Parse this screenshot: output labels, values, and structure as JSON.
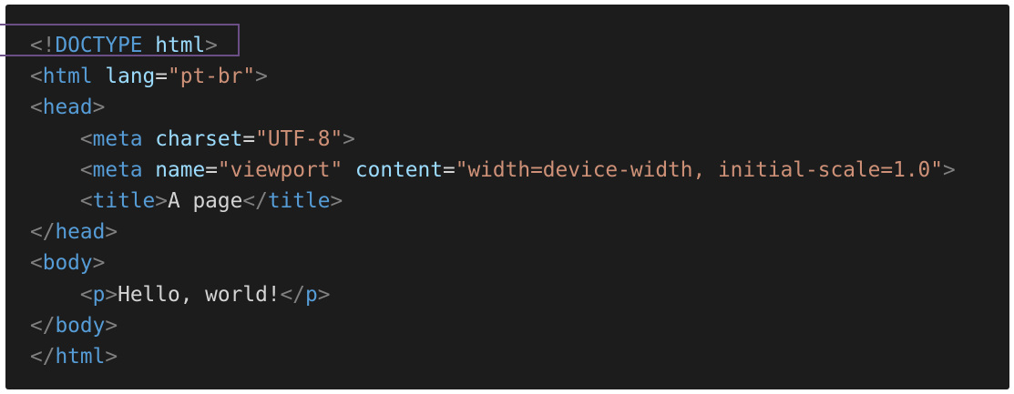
{
  "colors": {
    "background": "#1c1c1c",
    "punct": "#808080",
    "tag": "#569cd6",
    "attr": "#9cdcfe",
    "string": "#ce9178",
    "text": "#d4d4d4",
    "highlight": "#6b4e86"
  },
  "lines": [
    {
      "indent": 0,
      "tokens": [
        [
          "p",
          "<!"
        ],
        [
          "t",
          "DOCTYPE"
        ],
        [
          "x",
          " "
        ],
        [
          "a",
          "html"
        ],
        [
          "p",
          ">"
        ]
      ]
    },
    {
      "indent": 0,
      "tokens": [
        [
          "p",
          "<"
        ],
        [
          "t",
          "html"
        ],
        [
          "x",
          " "
        ],
        [
          "a",
          "lang"
        ],
        [
          "x",
          "="
        ],
        [
          "s",
          "\"pt-br\""
        ],
        [
          "p",
          ">"
        ]
      ]
    },
    {
      "indent": 0,
      "tokens": [
        [
          "p",
          "<"
        ],
        [
          "t",
          "head"
        ],
        [
          "p",
          ">"
        ]
      ]
    },
    {
      "indent": 1,
      "tokens": [
        [
          "p",
          "<"
        ],
        [
          "t",
          "meta"
        ],
        [
          "x",
          " "
        ],
        [
          "a",
          "charset"
        ],
        [
          "x",
          "="
        ],
        [
          "s",
          "\"UTF-8\""
        ],
        [
          "p",
          ">"
        ]
      ]
    },
    {
      "indent": 1,
      "tokens": [
        [
          "p",
          "<"
        ],
        [
          "t",
          "meta"
        ],
        [
          "x",
          " "
        ],
        [
          "a",
          "name"
        ],
        [
          "x",
          "="
        ],
        [
          "s",
          "\"viewport\""
        ],
        [
          "x",
          " "
        ],
        [
          "a",
          "content"
        ],
        [
          "x",
          "="
        ],
        [
          "s",
          "\"width=device-width, initial-scale=1.0\""
        ],
        [
          "p",
          ">"
        ]
      ]
    },
    {
      "indent": 1,
      "tokens": [
        [
          "p",
          "<"
        ],
        [
          "t",
          "title"
        ],
        [
          "p",
          ">"
        ],
        [
          "x",
          "A page"
        ],
        [
          "p",
          "</"
        ],
        [
          "t",
          "title"
        ],
        [
          "p",
          ">"
        ]
      ]
    },
    {
      "indent": 0,
      "tokens": [
        [
          "p",
          "</"
        ],
        [
          "t",
          "head"
        ],
        [
          "p",
          ">"
        ]
      ]
    },
    {
      "indent": 0,
      "tokens": [
        [
          "p",
          "<"
        ],
        [
          "t",
          "body"
        ],
        [
          "p",
          ">"
        ]
      ]
    },
    {
      "indent": 1,
      "tokens": [
        [
          "p",
          "<"
        ],
        [
          "t",
          "p"
        ],
        [
          "p",
          ">"
        ],
        [
          "x",
          "Hello, world!"
        ],
        [
          "p",
          "</"
        ],
        [
          "t",
          "p"
        ],
        [
          "p",
          ">"
        ]
      ]
    },
    {
      "indent": 0,
      "tokens": [
        [
          "p",
          "</"
        ],
        [
          "t",
          "body"
        ],
        [
          "p",
          ">"
        ]
      ]
    },
    {
      "indent": 0,
      "tokens": [
        [
          "p",
          "</"
        ],
        [
          "t",
          "html"
        ],
        [
          "p",
          ">"
        ]
      ]
    }
  ]
}
